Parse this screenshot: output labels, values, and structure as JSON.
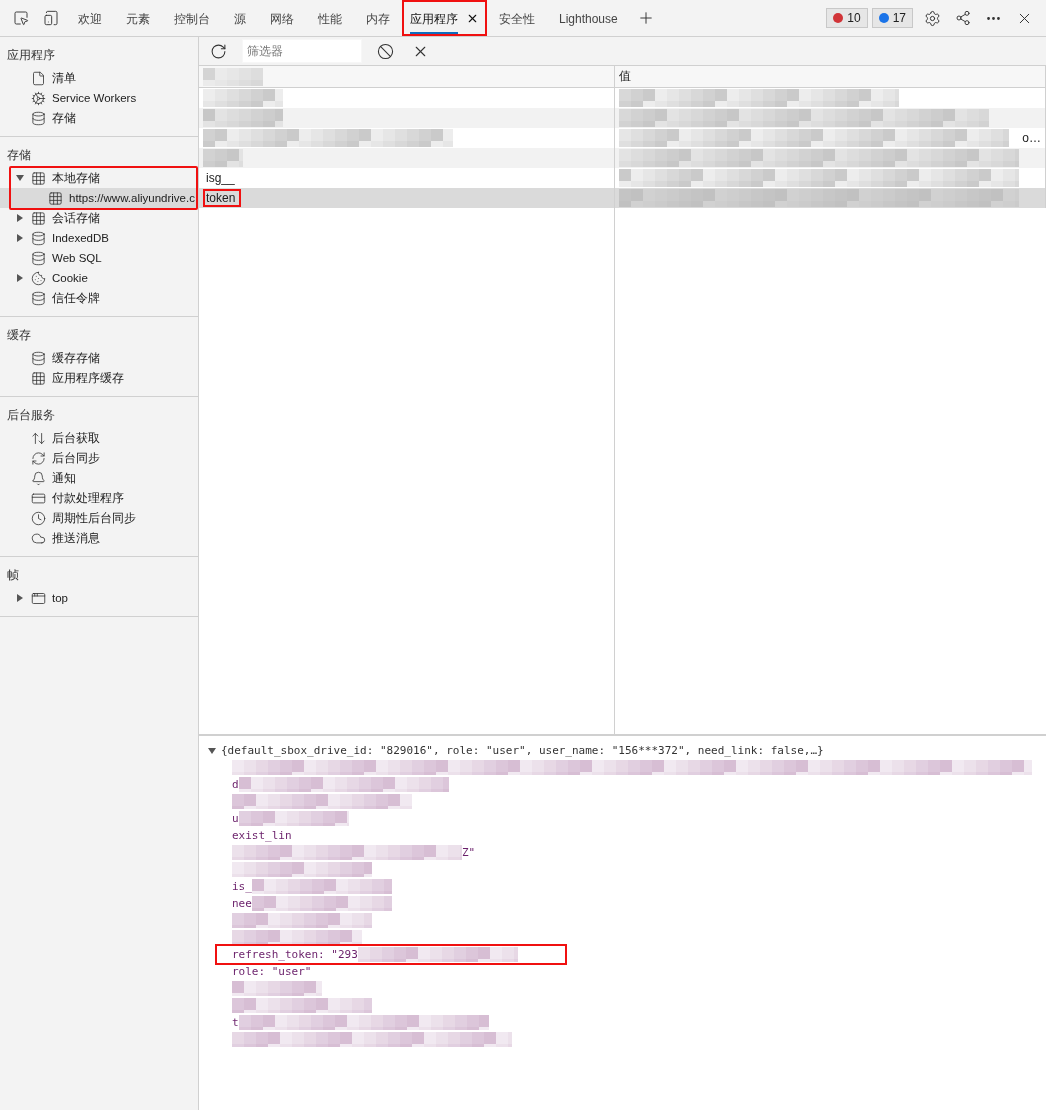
{
  "tabs": [
    {
      "label": "欢迎",
      "selected": false,
      "highlighted": false
    },
    {
      "label": "元素",
      "selected": false,
      "highlighted": false
    },
    {
      "label": "控制台",
      "selected": false,
      "highlighted": false
    },
    {
      "label": "源",
      "selected": false,
      "highlighted": false
    },
    {
      "label": "网络",
      "selected": false,
      "highlighted": false
    },
    {
      "label": "性能",
      "selected": false,
      "highlighted": false
    },
    {
      "label": "内存",
      "selected": false,
      "highlighted": false
    },
    {
      "label": "应用程序",
      "selected": true,
      "highlighted": true
    },
    {
      "label": "安全性",
      "selected": false,
      "highlighted": false
    },
    {
      "label": "Lighthouse",
      "selected": false,
      "highlighted": false
    }
  ],
  "issues": {
    "errors": "10",
    "messages": "17"
  },
  "sidebar": [
    {
      "title": "应用程序",
      "items": [
        {
          "label": "清单",
          "kind": "file",
          "selected": false
        },
        {
          "label": "Service Workers",
          "kind": "gear",
          "selected": false
        },
        {
          "label": "存储",
          "kind": "database",
          "selected": false
        }
      ]
    },
    {
      "title": "存储",
      "items": [
        {
          "label": "本地存储",
          "kind": "grid",
          "selected": false,
          "expanded": true,
          "highlighted": true,
          "children": [
            {
              "label": "https://www.aliyundrive.c",
              "kind": "grid",
              "selected": true
            }
          ]
        },
        {
          "label": "会话存储",
          "kind": "grid",
          "selected": false,
          "expanded": false
        },
        {
          "label": "IndexedDB",
          "kind": "database",
          "selected": false,
          "expanded": false
        },
        {
          "label": "Web SQL",
          "kind": "database",
          "selected": false
        },
        {
          "label": "Cookie",
          "kind": "cookie",
          "selected": false,
          "expanded": false
        },
        {
          "label": "信任令牌",
          "kind": "database",
          "selected": false
        }
      ]
    },
    {
      "title": "缓存",
      "items": [
        {
          "label": "缓存存储",
          "kind": "database",
          "selected": false
        },
        {
          "label": "应用程序缓存",
          "kind": "grid",
          "selected": false
        }
      ]
    },
    {
      "title": "后台服务",
      "items": [
        {
          "label": "后台获取",
          "kind": "updown",
          "selected": false
        },
        {
          "label": "后台同步",
          "kind": "sync",
          "selected": false
        },
        {
          "label": "通知",
          "kind": "bell",
          "selected": false
        },
        {
          "label": "付款处理程序",
          "kind": "card",
          "selected": false
        },
        {
          "label": "周期性后台同步",
          "kind": "clock",
          "selected": false
        },
        {
          "label": "推送消息",
          "kind": "cloud",
          "selected": false
        }
      ]
    },
    {
      "title": "帧",
      "items": [
        {
          "label": "top",
          "kind": "window",
          "selected": false,
          "expanded": false
        }
      ]
    }
  ],
  "toolbar": {
    "filter_placeholder": "筛选器"
  },
  "table": {
    "columns": [
      "值"
    ],
    "rows": [
      {
        "selected": false
      },
      {
        "selected": false
      },
      {
        "value_tail": "o…",
        "selected": false
      },
      {
        "selected": false
      },
      {
        "key": "isg__",
        "selected": false
      },
      {
        "key": "token",
        "selected": true,
        "highlighted": true
      }
    ]
  },
  "detail": {
    "summary": "{default_sbox_drive_id: \"829016\", role: \"user\", user_name: \"156***372\", need_link: false,…}",
    "expanded": true,
    "lines": [
      {
        "highlighted": false
      },
      {
        "text": "d",
        "highlighted": false
      },
      {
        "highlighted": false
      },
      {
        "text": "u",
        "highlighted": false
      },
      {
        "text": "exist_lin",
        "highlighted": false
      },
      {
        "suffix": "Z\"",
        "highlighted": false
      },
      {
        "highlighted": false
      },
      {
        "text": "is_",
        "highlighted": false
      },
      {
        "text": "nee",
        "highlighted": false
      },
      {
        "highlighted": false
      },
      {
        "highlighted": false
      },
      {
        "text": "refresh_token: \"293",
        "highlighted": true
      },
      {
        "text": "role: \"user\"",
        "highlighted": false
      },
      {
        "highlighted": false
      },
      {
        "highlighted": false
      },
      {
        "text": "t",
        "highlighted": false
      },
      {
        "highlighted": false
      }
    ]
  }
}
